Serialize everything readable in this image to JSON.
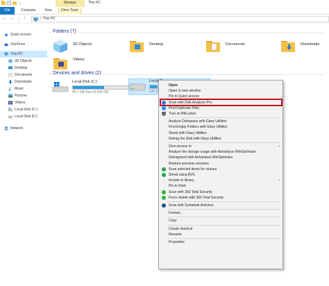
{
  "window": {
    "title": "This PC",
    "manage_tab": "Manage"
  },
  "ribbon": {
    "tabs": [
      "File",
      "Computer",
      "View",
      "Drive Tools"
    ]
  },
  "address": {
    "separator": ">",
    "path": "This PC"
  },
  "nav_buttons": [
    "←",
    "→",
    "⌄",
    "↑"
  ],
  "sidebar": {
    "items": [
      {
        "label": "Quick access",
        "icon": "star-icon"
      },
      {
        "label": "OneDrive",
        "icon": "cloud-icon"
      },
      {
        "label": "This PC",
        "icon": "pc-icon",
        "selected": true
      },
      {
        "label": "3D Objects",
        "icon": "cube-icon"
      },
      {
        "label": "Desktop",
        "icon": "desktop-icon"
      },
      {
        "label": "Documents",
        "icon": "document-icon"
      },
      {
        "label": "Downloads",
        "icon": "download-icon"
      },
      {
        "label": "Music",
        "icon": "music-icon"
      },
      {
        "label": "Pictures",
        "icon": "pictures-icon"
      },
      {
        "label": "Videos",
        "icon": "video-icon"
      },
      {
        "label": "Local Disk (C:)",
        "icon": "drive-icon"
      },
      {
        "label": "Local Disk (D:)",
        "icon": "drive-icon"
      },
      {
        "label": "Network",
        "icon": "network-icon"
      }
    ]
  },
  "folders_section": {
    "title": "Folders (7)",
    "items": [
      {
        "label": "3D Objects",
        "icon": "cube-folder-icon"
      },
      {
        "label": "Desktop",
        "icon": "folder-icon"
      },
      {
        "label": "Documents",
        "icon": "folder-icon"
      },
      {
        "label": "Downloads",
        "icon": "folder-icon"
      },
      {
        "label": "Videos",
        "icon": "folder-icon"
      }
    ]
  },
  "drives_section": {
    "title": "Devices and drives (2)",
    "drives": [
      {
        "name": "Local Disk (C:)",
        "size": "95.7 GB free of 204 GB",
        "used_fraction": 0.53
      },
      {
        "name": "Local Di",
        "size": "132 GB",
        "used_fraction": 0.4,
        "selected": true
      }
    ]
  },
  "context_menu": {
    "items": [
      {
        "label": "Open",
        "bold": true
      },
      {
        "label": "Open in new window"
      },
      {
        "label": "Pin to Quick access"
      },
      {
        "label": "Scan with Disk Analyzer Pro",
        "icon": "disk-analyzer-icon",
        "highlighted": true
      },
      {
        "label": "Find Duplicate Files",
        "icon": "duplicate-icon"
      },
      {
        "label": "Turn on BitLocker",
        "icon": "shield-icon"
      },
      {
        "sep": true
      },
      {
        "label": "Analyze Diskspace with Glary Utilities"
      },
      {
        "label": "Find Empty Folders with Glary Utilities"
      },
      {
        "label": "Shred with Glary Utilities"
      },
      {
        "label": "Defrag the Disk with Glary Utilities"
      },
      {
        "sep": true
      },
      {
        "label": "Give access to",
        "submenu": true
      },
      {
        "label": "Analyze the storage usage with Ashampoo WinOptimizer"
      },
      {
        "label": "Defragment with Ashampoo WinOptimizer"
      },
      {
        "label": "Restore previous versions"
      },
      {
        "label": "Scan selected items for viruses",
        "icon": "avg-icon"
      },
      {
        "label": "Shred using AVG",
        "icon": "avg-icon"
      },
      {
        "label": "Include in library",
        "submenu": true
      },
      {
        "label": "Pin to Start"
      },
      {
        "label": "Scan with 360 Total Security",
        "icon": "security-360-icon"
      },
      {
        "label": "Force delete with 360 Total Security",
        "icon": "security-360-icon"
      },
      {
        "sep": true
      },
      {
        "label": "Scan with Systweak Antivirus",
        "icon": "systweak-icon"
      },
      {
        "sep": true
      },
      {
        "label": "Format..."
      },
      {
        "sep": true
      },
      {
        "label": "Copy"
      },
      {
        "sep": true
      },
      {
        "label": "Create shortcut"
      },
      {
        "label": "Rename"
      },
      {
        "sep": true
      },
      {
        "label": "Properties"
      }
    ]
  },
  "colors": {
    "accent": "#1979ca",
    "selection": "#cce8ff",
    "highlight_border": "#c0101b",
    "folder_yellow": "#f3c148",
    "drive_fill": "#26a0da"
  }
}
